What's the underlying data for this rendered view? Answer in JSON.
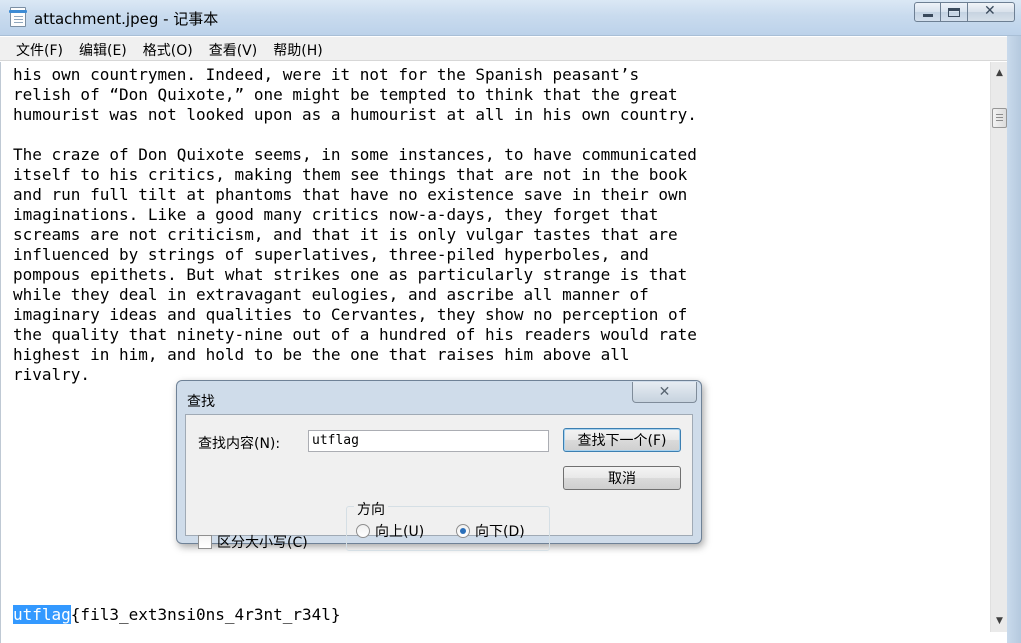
{
  "window": {
    "title": "attachment.jpeg - 记事本",
    "controls": {
      "minimize": "—",
      "maximize": "□",
      "close": "✕"
    }
  },
  "menu": [
    "文件(F)",
    "编辑(E)",
    "格式(O)",
    "查看(V)",
    "帮助(H)"
  ],
  "document": {
    "lines": [
      "his own countrymen. Indeed, were it not for the Spanish peasant’s",
      "relish of “Don Quixote,” one might be tempted to think that the great",
      "humourist was not looked upon as a humourist at all in his own country.",
      "",
      "The craze of Don Quixote seems, in some instances, to have communicated",
      "itself to his critics, making them see things that are not in the book",
      "and run full tilt at phantoms that have no existence save in their own",
      "imaginations. Like a good many critics now-a-days, they forget that",
      "screams are not criticism, and that it is only vulgar tastes that are",
      "influenced by strings of superlatives, three-piled hyperboles, and",
      "pompous epithets. But what strikes one as particularly strange is that",
      "while they deal in extravagant eulogies, and ascribe all manner of",
      "imaginary ideas and qualities to Cervantes, they show no perception of",
      "the quality that ninety-nine out of a hundred of his readers would rate",
      "highest in him, and hold to be the one that raises him above all",
      "rivalry."
    ],
    "last_line_selected": "utflag",
    "last_line_rest": "{fil3_ext3nsi0ns_4r3nt_r34l}"
  },
  "find_dialog": {
    "title": "查找",
    "close": "✕",
    "find_label": "查找内容(N):",
    "find_value": "utflag",
    "find_next_button": "查找下一个(F)",
    "cancel_button": "取消",
    "direction_label": "方向",
    "up_label": "向上(U)",
    "down_label": "向下(D)",
    "direction_selected": "down",
    "match_case_label": "区分大小写(C)",
    "match_case_checked": false
  }
}
